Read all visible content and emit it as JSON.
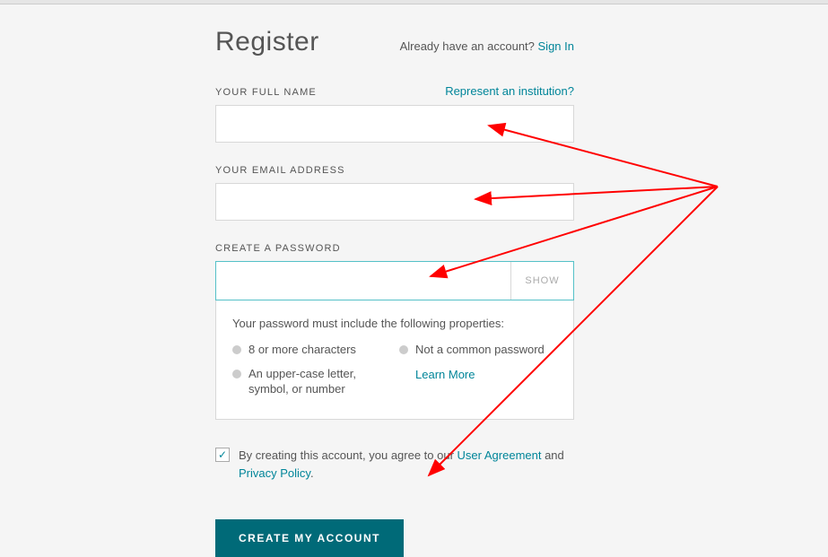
{
  "header": {
    "title": "Register",
    "already_text": "Already have an account? ",
    "sign_in": "Sign In"
  },
  "fields": {
    "name_label": "YOUR FULL NAME",
    "represent": "Represent an institution?",
    "email_label": "YOUR EMAIL ADDRESS",
    "password_label": "CREATE A PASSWORD",
    "show_btn": "SHOW"
  },
  "hints": {
    "title": "Your password must include the following properties:",
    "item1": "8 or more characters",
    "item2": "Not a common password",
    "item3": "An upper-case letter, symbol, or number",
    "learn_more": "Learn More"
  },
  "agree": {
    "prefix": "By creating this account, you agree to our ",
    "user_agreement": "User Agreement",
    "and": " and ",
    "privacy": "Privacy Policy",
    "period": "."
  },
  "submit": {
    "label": "CREATE MY ACCOUNT"
  }
}
